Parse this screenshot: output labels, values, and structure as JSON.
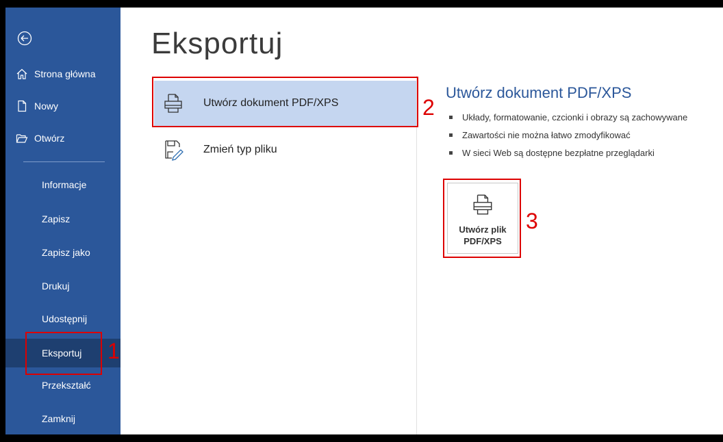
{
  "sidebar": {
    "top_items": [
      {
        "label": "Strona główna",
        "icon": "home-icon"
      },
      {
        "label": "Nowy",
        "icon": "new-document-icon"
      },
      {
        "label": "Otwórz",
        "icon": "folder-open-icon"
      }
    ],
    "nav_items": [
      {
        "label": "Informacje"
      },
      {
        "label": "Zapisz"
      },
      {
        "label": "Zapisz jako"
      },
      {
        "label": "Drukuj"
      },
      {
        "label": "Udostępnij"
      },
      {
        "label": "Eksportuj",
        "active": true
      },
      {
        "label": "Przekształć"
      },
      {
        "label": "Zamknij"
      }
    ],
    "bg_color": "#2b579a",
    "active_color": "#1e3f70"
  },
  "main": {
    "title": "Eksportuj",
    "options": [
      {
        "label": "Utwórz dokument PDF/XPS",
        "icon": "pdf-printer-icon",
        "selected": true
      },
      {
        "label": "Zmień typ pliku",
        "icon": "change-file-type-icon",
        "selected": false
      }
    ]
  },
  "detail": {
    "title": "Utwórz dokument PDF/XPS",
    "bullets": [
      "Układy, formatowanie, czcionki i obrazy są zachowywane",
      "Zawartości nie można łatwo zmodyfikować",
      "W sieci Web są dostępne bezpłatne przeglądarki"
    ],
    "button_label": "Utwórz plik\nPDF/XPS"
  },
  "annotations": {
    "step1": "1",
    "step2": "2",
    "step3": "3",
    "color": "#dd0000"
  }
}
